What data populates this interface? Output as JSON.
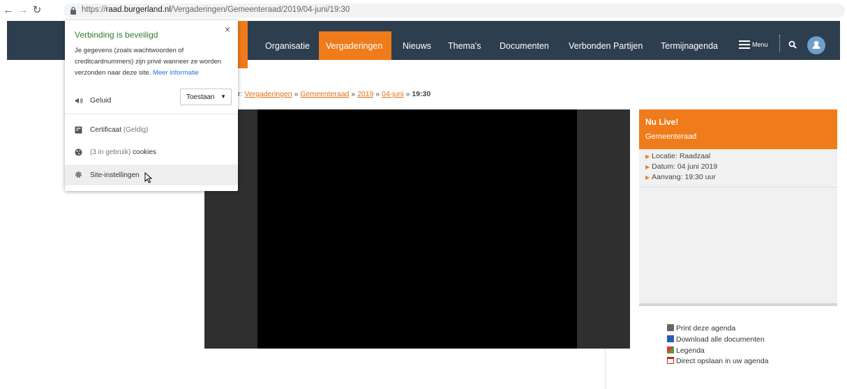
{
  "browser": {
    "url_scheme": "https://",
    "url_host": "raad.burgerland.nl",
    "url_path": "/Vergaderingen/Gemeenteraad/2019/04-juni/19:30"
  },
  "header": {
    "nav": [
      "Organisatie",
      "Vergaderingen",
      "Nieuws",
      "Thema's",
      "Documenten",
      "Verbonden Partijen",
      "Termijnagenda"
    ],
    "active_nav": "Vergaderingen",
    "menu_label": "Menu",
    "accent_color": "#ef7b1b",
    "header_color": "#2d3e4f"
  },
  "breadcrumb": {
    "prefix": "r:",
    "items": [
      "Vergaderingen",
      "Gemeenteraad",
      "2019",
      "04-juni"
    ],
    "current": "19:30",
    "separator": "»"
  },
  "live_panel": {
    "title": "Nu Live!",
    "subtitle": "Gemeenteraad",
    "info": [
      "Locatie: Raadzaal",
      "Datum: 04 juni 2019",
      "Aanvang: 19:30 uur"
    ]
  },
  "agenda_links": [
    "Print deze agenda",
    "Download alle documenten",
    "Legenda",
    "Direct opslaan in uw agenda"
  ],
  "popup": {
    "title": "Verbinding is beveiligd",
    "close": "×",
    "description": "Je gegevens (zoals wachtwoorden of creditcardnummers) zijn privé wanneer ze worden verzonden naar deze site.",
    "more_info": "Meer informatie",
    "sound_label": "Geluid",
    "sound_value": "Toestaan",
    "certificate": "Certificaat",
    "certificate_status": "(Geldig)",
    "cookies_count": "(3 in gebruik)",
    "cookies_label": "cookies",
    "site_settings": "Site-instellingen"
  }
}
